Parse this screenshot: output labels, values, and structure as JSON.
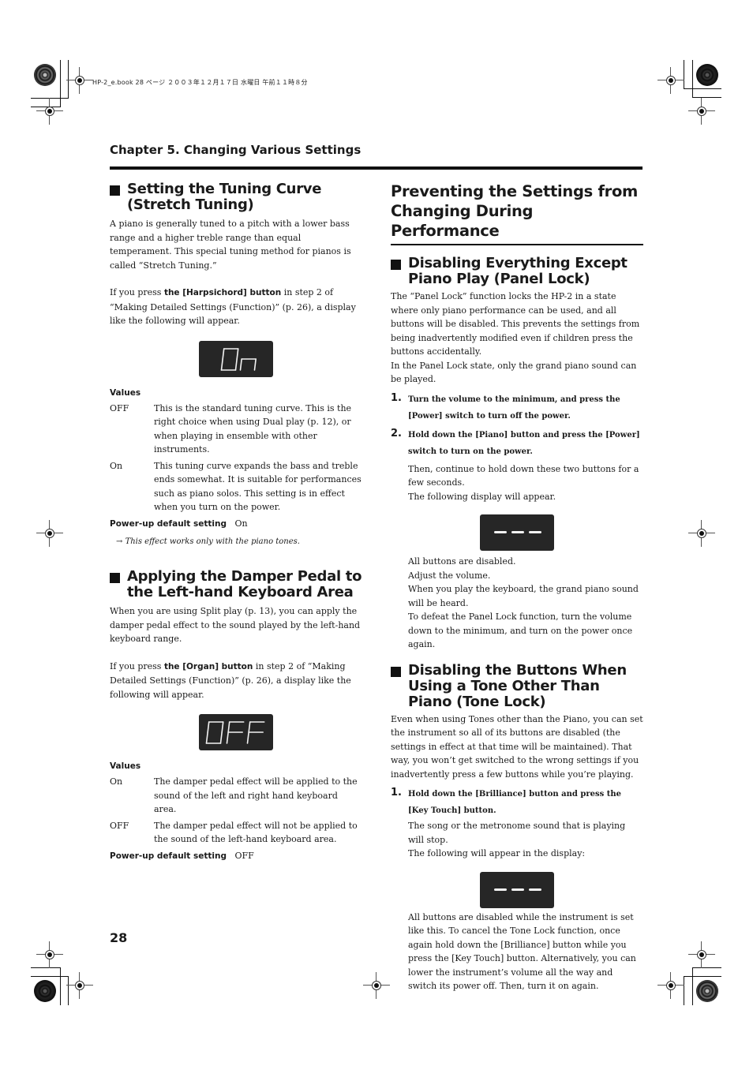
{
  "header_meta": "HP-2_e.book  28 ページ  ２００３年１２月１７日  水曜日  午前１１時８分",
  "chapter_title": "Chapter 5. Changing Various Settings",
  "page_number": "28",
  "left": {
    "tuning": {
      "heading": "Setting the Tuning Curve (Stretch Tuning)",
      "intro": "A piano is generally tuned to a pitch with a lower bass range and a higher treble range than equal temperament. This special tuning method for pianos is called “Stretch Tuning.”",
      "press_prefix": "If you press ",
      "press_button": "the [Harpsichord] button",
      "press_suffix": " in step 2 of “Making Detailed Settings (Function)” (p. 26), a display like the following will appear.",
      "display": "On",
      "values_label": "Values",
      "values": [
        {
          "key": "OFF",
          "text": "This is the standard tuning curve. This is the right choice when using Dual play (p. 12), or when playing in ensemble with other instruments."
        },
        {
          "key": "On",
          "text": "This tuning curve expands the bass and treble ends somewhat. It is suitable for performances such as piano solos. This setting is in effect when you turn on the power."
        }
      ],
      "default_label": "Power-up default setting",
      "default_value": "On",
      "note": "This effect works only with the piano tones."
    },
    "damper": {
      "heading": "Applying the Damper Pedal to the Left-hand Keyboard Area",
      "intro": "When you are using Split play (p. 13), you can apply the damper pedal effect to the sound played by the left-hand keyboard range.",
      "press_prefix": "If you press ",
      "press_button": "the [Organ] button",
      "press_suffix": " in step 2 of “Making Detailed Settings (Function)” (p. 26), a display like the following will appear.",
      "display": "OFF",
      "values_label": "Values",
      "values": [
        {
          "key": "On",
          "text": "The damper pedal effect will be applied to the sound of the left and right hand keyboard area."
        },
        {
          "key": "OFF",
          "text": "The damper pedal effect will not be applied to the sound of the left-hand keyboard area."
        }
      ],
      "default_label": "Power-up default setting",
      "default_value": "OFF"
    }
  },
  "right": {
    "main_heading": "Preventing the Settings from Changing During Performance",
    "panel_lock": {
      "heading": "Disabling Everything Except Piano Play (Panel Lock)",
      "intro": "The “Panel Lock” function locks the HP-2 in a state where only piano performance can be used, and all buttons will be disabled. This prevents the settings from being inadvertently modified even if children press the buttons accidentally.",
      "intro2": "In the Panel Lock state, only the grand piano sound can be played.",
      "steps": [
        {
          "num": "1.",
          "text": "Turn the volume to the minimum, and press the [Power] switch to turn off the power."
        },
        {
          "num": "2.",
          "text": "Hold down the [Piano] button and press the [Power] switch to turn on the power."
        }
      ],
      "after_step": "Then, continue to hold down these two buttons for a few seconds.",
      "display_intro": "The following display will appear.",
      "display": "---",
      "after_display": [
        "All buttons are disabled.",
        "Adjust the volume.",
        "When you play the keyboard, the grand piano sound will be heard.",
        "To defeat the Panel Lock function, turn the volume down to the minimum, and turn on the power once again."
      ]
    },
    "tone_lock": {
      "heading": "Disabling the Buttons When Using a Tone Other Than Piano (Tone Lock)",
      "intro": "Even when using Tones other than the Piano, you can set the instrument so all of its buttons are disabled (the settings in effect at that time will be maintained). That way, you won’t get switched to the wrong settings if you inadvertently press a few buttons while you’re playing.",
      "steps": [
        {
          "num": "1.",
          "text": "Hold down the [Brilliance] button and press the [Key Touch] button."
        }
      ],
      "after_step": "The song or the metronome sound that is playing will stop.",
      "display_intro": "The following will appear in the display:",
      "display": "---",
      "after_display": "All buttons are disabled while the instrument is set like this. To cancel the Tone Lock function, once again hold down the [Brilliance] button while you press the [Key Touch] button. Alternatively, you can lower the instrument’s volume all the way and switch its power off. Then, turn it on again."
    }
  }
}
